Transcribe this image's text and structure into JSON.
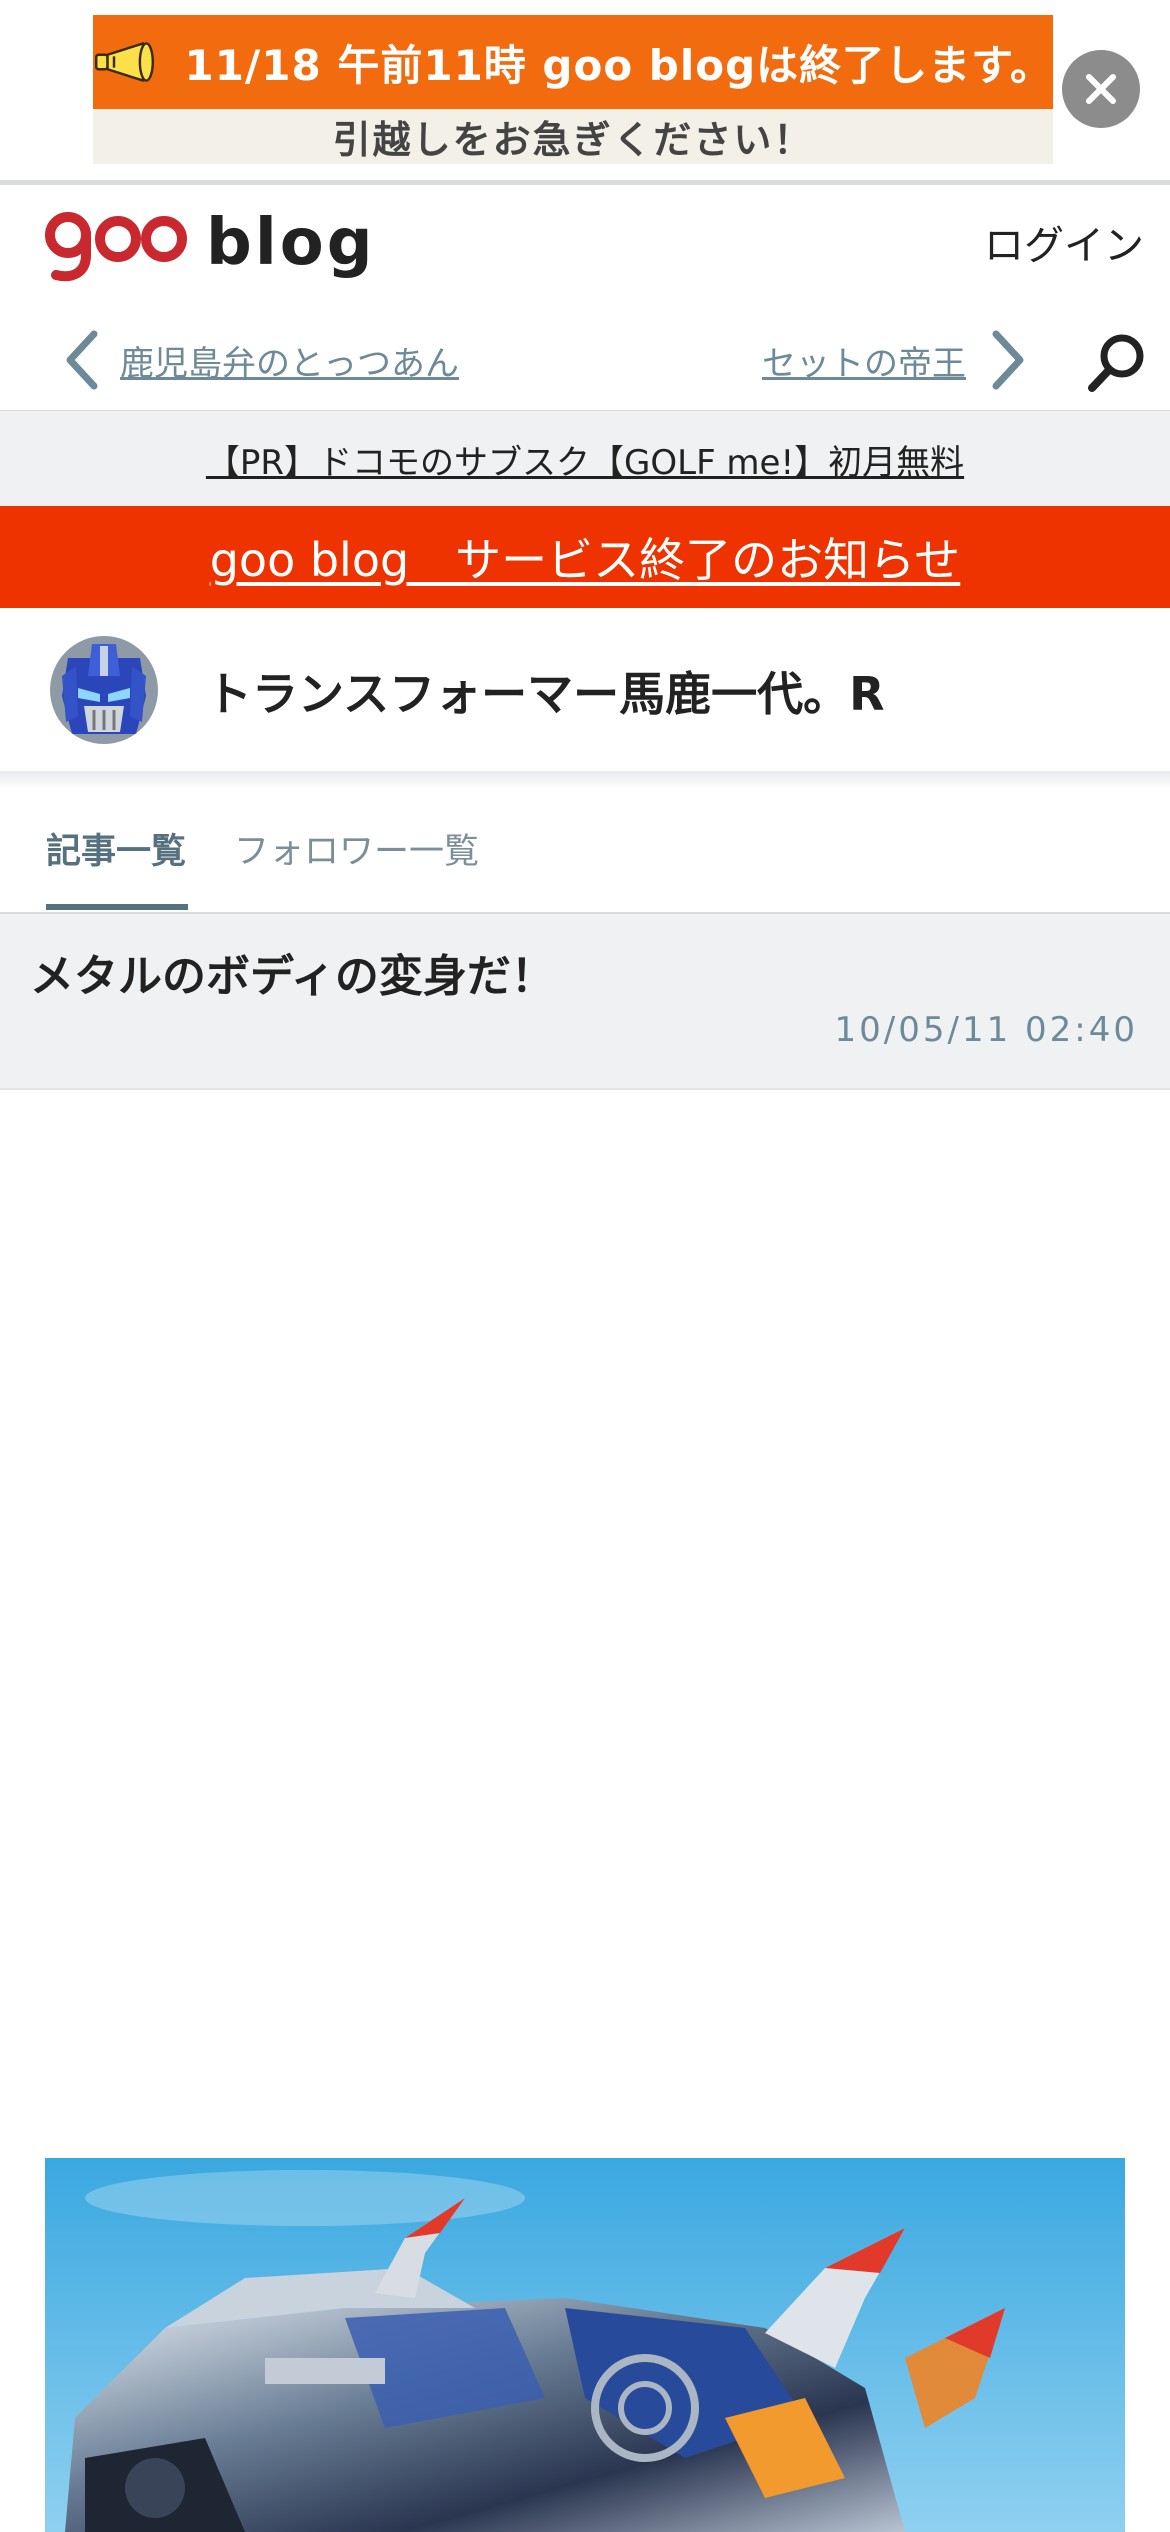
{
  "promo_banner": {
    "line1": "11/18 午前11時 goo blogは終了します。",
    "line2": "引越しをお急ぎください！",
    "icon": "megaphone-icon",
    "close_icon": "close-icon",
    "colors": {
      "accent": "#f26b0f",
      "subbar": "#f3f0e8"
    }
  },
  "header": {
    "logo_goo": "goo",
    "logo_blog": "blog",
    "login_label": "ログイン"
  },
  "nav": {
    "prev_label": "鹿児島弁のとっつあん",
    "next_label": "セットの帝王",
    "prev_icon": "chevron-left-icon",
    "next_icon": "chevron-right-icon",
    "search_icon": "search-icon"
  },
  "pr": {
    "label": "【PR】ドコモのサブスク【GOLF me!】初月無料"
  },
  "notice": {
    "label": "goo blog　サービス終了のお知らせ",
    "color": "#ee3300"
  },
  "blog": {
    "title": "トランスフォーマー馬鹿一代。R",
    "avatar_icon": "robot-avatar-icon"
  },
  "tabs": [
    {
      "label": "記事一覧",
      "active": true
    },
    {
      "label": "フォロワー一覧",
      "active": false
    }
  ],
  "article": {
    "title": "メタルのボディの変身だ！",
    "date": "10/05/11 02:40"
  }
}
